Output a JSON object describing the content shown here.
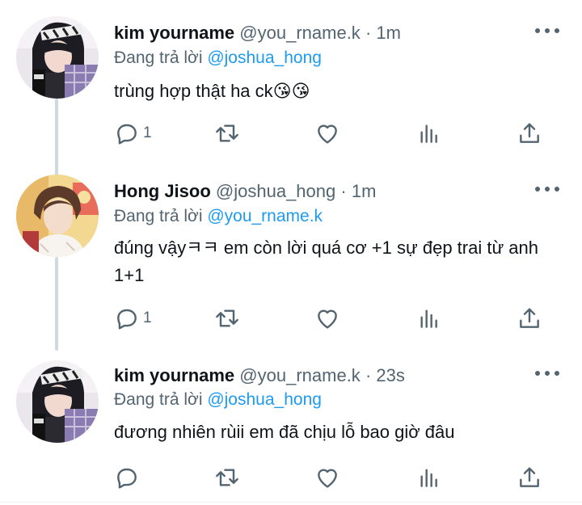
{
  "tweets": [
    {
      "name": "kim yourname",
      "handle": "@you_rname.k",
      "time": "1m",
      "sep": "·",
      "replying_prefix": "Đang trả lời",
      "replying_to": "@joshua_hong",
      "text": "trùng hợp thật ha ck😘😘",
      "reply_count": "1",
      "retweet_count": "",
      "like_count": ""
    },
    {
      "name": "Hong Jisoo",
      "handle": "@joshua_hong",
      "time": "1m",
      "sep": "·",
      "replying_prefix": "Đang trả lời",
      "replying_to": "@you_rname.k",
      "text": "đúng vậyㅋㅋ em còn lời quá cơ +1 sự đẹp trai từ anh 1+1",
      "reply_count": "1",
      "retweet_count": "",
      "like_count": ""
    },
    {
      "name": "kim yourname",
      "handle": "@you_rname.k",
      "time": "23s",
      "sep": "·",
      "replying_prefix": "Đang trả lời",
      "replying_to": "@joshua_hong",
      "text": "đương nhiên rùii em đã chịu lỗ bao giờ đâu",
      "reply_count": "",
      "retweet_count": "",
      "like_count": ""
    }
  ],
  "colors": {
    "text": "#0f1419",
    "secondary": "#536471",
    "link": "#1d9bf0",
    "thread_line": "#cfd9de"
  },
  "icons": [
    "more-icon",
    "reply-icon",
    "retweet-icon",
    "like-icon",
    "analytics-icon",
    "share-icon"
  ]
}
